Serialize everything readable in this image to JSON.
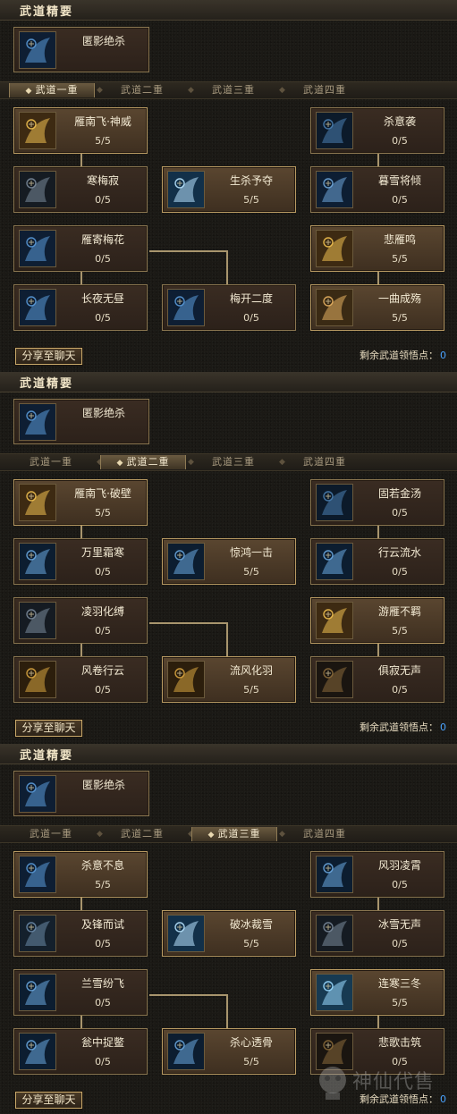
{
  "panels": [
    {
      "section_title": "武道精要",
      "essence": {
        "name": "匿影绝杀",
        "icon": "wolf-fang-icon"
      },
      "tabs": [
        {
          "label": "武道一重",
          "active": true
        },
        {
          "label": "武道二重",
          "active": false
        },
        {
          "label": "武道三重",
          "active": false
        },
        {
          "label": "武道四重",
          "active": false
        }
      ],
      "skills": [
        {
          "name": "雁南飞·神威",
          "level": "5/5",
          "icon": "wing-fire-icon",
          "active": true
        },
        {
          "name": "杀意袭",
          "level": "0/5",
          "icon": "ice-shard-icon",
          "active": false
        },
        {
          "name": "寒梅寂",
          "level": "0/5",
          "icon": "blade-icon",
          "active": false
        },
        {
          "name": "生杀予夺",
          "level": "5/5",
          "icon": "ice-storm-icon",
          "active": true
        },
        {
          "name": "暮雪将倾",
          "level": "0/5",
          "icon": "snow-burst-icon",
          "active": false
        },
        {
          "name": "雁寄梅花",
          "level": "0/5",
          "icon": "wolf-fang-icon",
          "active": false
        },
        {
          "name": "悲雁鸣",
          "level": "5/5",
          "icon": "wing-fire-icon",
          "active": true
        },
        {
          "name": "长夜无昼",
          "level": "0/5",
          "icon": "wolf-fang-icon",
          "active": false
        },
        {
          "name": "梅开二度",
          "level": "0/5",
          "icon": "wolf-fang-icon",
          "active": false
        },
        {
          "name": "一曲成殇",
          "level": "5/5",
          "icon": "flame-burst-icon",
          "active": true
        }
      ],
      "share_label": "分享至聊天",
      "points_label": "剩余武道领悟点：",
      "points_value": "0"
    },
    {
      "section_title": "武道精要",
      "essence": {
        "name": "匿影绝杀",
        "icon": "wolf-fang-icon"
      },
      "tabs": [
        {
          "label": "武道一重",
          "active": false
        },
        {
          "label": "武道二重",
          "active": true
        },
        {
          "label": "武道三重",
          "active": false
        },
        {
          "label": "武道四重",
          "active": false
        }
      ],
      "skills": [
        {
          "name": "雁南飞·破壁",
          "level": "5/5",
          "icon": "wing-fire-icon",
          "active": true
        },
        {
          "name": "固若金汤",
          "level": "0/5",
          "icon": "ice-shard-icon",
          "active": false
        },
        {
          "name": "万里霜寒",
          "level": "0/5",
          "icon": "frost-slash-icon",
          "active": false
        },
        {
          "name": "惊鸿一击",
          "level": "5/5",
          "icon": "frost-slash-icon",
          "active": true
        },
        {
          "name": "行云流水",
          "level": "0/5",
          "icon": "frost-slash-icon",
          "active": false
        },
        {
          "name": "凌羽化缚",
          "level": "0/5",
          "icon": "blade-icon",
          "active": false
        },
        {
          "name": "游雁不羁",
          "level": "5/5",
          "icon": "wing-fire-icon",
          "active": true
        },
        {
          "name": "风卷行云",
          "level": "0/5",
          "icon": "golden-wind-icon",
          "active": false
        },
        {
          "name": "流风化羽",
          "level": "5/5",
          "icon": "golden-wind-icon",
          "active": true
        },
        {
          "name": "俱寂无声",
          "level": "0/5",
          "icon": "shadow-figure-icon",
          "active": false
        }
      ],
      "share_label": "分享至聊天",
      "points_label": "剩余武道领悟点：",
      "points_value": "0"
    },
    {
      "section_title": "武道精要",
      "essence": {
        "name": "匿影绝杀",
        "icon": "wolf-fang-icon"
      },
      "tabs": [
        {
          "label": "武道一重",
          "active": false
        },
        {
          "label": "武道二重",
          "active": false
        },
        {
          "label": "武道三重",
          "active": true
        },
        {
          "label": "武道四重",
          "active": false
        }
      ],
      "skills": [
        {
          "name": "杀意不息",
          "level": "5/5",
          "icon": "wolf-fang-icon",
          "active": true
        },
        {
          "name": "风羽凌霄",
          "level": "0/5",
          "icon": "frost-slash-icon",
          "active": false
        },
        {
          "name": "及锋而试",
          "level": "0/5",
          "icon": "hooded-figure-icon",
          "active": false
        },
        {
          "name": "破冰裁雪",
          "level": "5/5",
          "icon": "ice-storm-icon",
          "active": true
        },
        {
          "name": "冰雪无声",
          "level": "0/5",
          "icon": "blade-icon",
          "active": false
        },
        {
          "name": "兰雪纷飞",
          "level": "0/5",
          "icon": "frost-slash-icon",
          "active": false
        },
        {
          "name": "连寒三冬",
          "level": "5/5",
          "icon": "ice-beast-icon",
          "active": true
        },
        {
          "name": "瓮中捉鳖",
          "level": "0/5",
          "icon": "frost-slash-icon",
          "active": false
        },
        {
          "name": "杀心透骨",
          "level": "5/5",
          "icon": "frost-slash-icon",
          "active": true
        },
        {
          "name": "悲歌击筑",
          "level": "0/5",
          "icon": "shadow-figure-icon",
          "active": false
        }
      ],
      "share_label": "分享至聊天",
      "points_label": "剩余武道领悟点：",
      "points_value": "0"
    }
  ],
  "watermark": {
    "text": "神仙代售",
    "icon": "mascot-logo-icon"
  }
}
